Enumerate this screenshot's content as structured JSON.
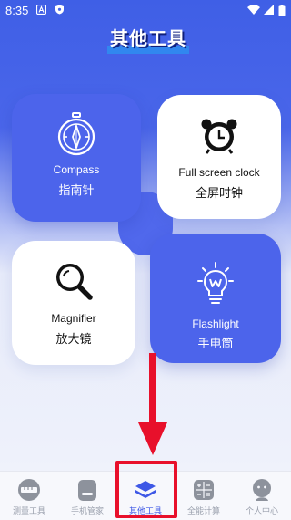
{
  "status_bar": {
    "time": "8:35",
    "icons": [
      "a-badge-icon",
      "shield-icon",
      "wifi-icon",
      "signal-icon",
      "battery-icon"
    ]
  },
  "page_title": "其他工具",
  "cards": [
    {
      "en": "Compass",
      "zh": "指南针",
      "icon": "compass-icon",
      "style": "blue"
    },
    {
      "en": "Full screen clock",
      "zh": "全屏时钟",
      "icon": "alarm-clock-icon",
      "style": "white"
    },
    {
      "en": "Magnifier",
      "zh": "放大镜",
      "icon": "magnifier-icon",
      "style": "white"
    },
    {
      "en": "Flashlight",
      "zh": "手电筒",
      "icon": "lightbulb-icon",
      "style": "blue"
    }
  ],
  "nav": [
    {
      "label": "测量工具",
      "icon": "measure-tools-icon",
      "active": false
    },
    {
      "label": "手机管家",
      "icon": "phone-manager-icon",
      "active": false
    },
    {
      "label": "其他工具",
      "icon": "layers-icon",
      "active": true
    },
    {
      "label": "全能计算",
      "icon": "calculator-icon",
      "active": false
    },
    {
      "label": "个人中心",
      "icon": "profile-icon",
      "active": false
    }
  ],
  "colors": {
    "accent": "#4c64eb",
    "annotation_red": "#e8102b"
  }
}
